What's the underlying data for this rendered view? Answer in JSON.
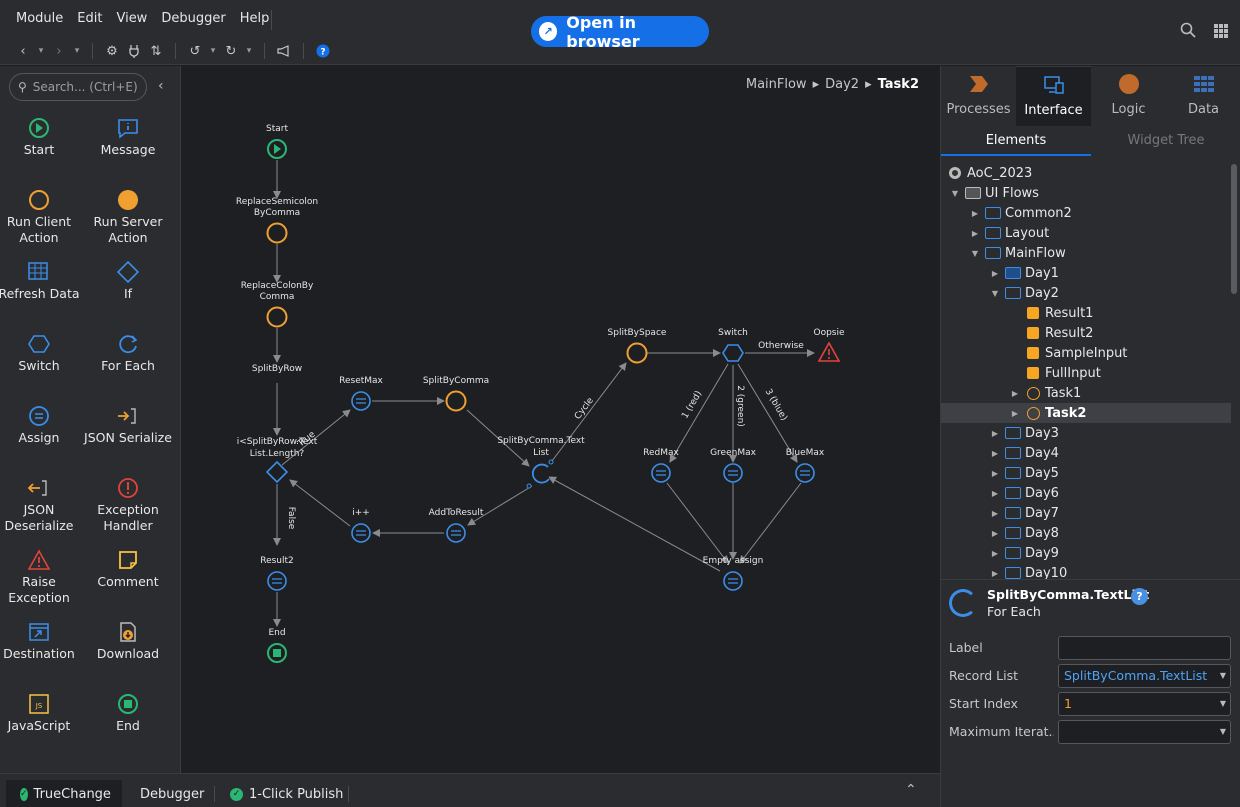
{
  "menu": [
    "Module",
    "Edit",
    "View",
    "Debugger",
    "Help"
  ],
  "open_browser": "Open in browser",
  "toolbox": {
    "search_placeholder": "Search... (Ctrl+E)",
    "tools": [
      {
        "label": "Start",
        "icon": "start-icon"
      },
      {
        "label": "Message",
        "icon": "message-icon"
      },
      {
        "label": "Run Client Action",
        "icon": "run-client-action-icon"
      },
      {
        "label": "Run Server Action",
        "icon": "run-server-action-icon"
      },
      {
        "label": "Refresh Data",
        "icon": "refresh-data-icon"
      },
      {
        "label": "If",
        "icon": "if-icon"
      },
      {
        "label": "Switch",
        "icon": "switch-icon"
      },
      {
        "label": "For Each",
        "icon": "for-each-icon"
      },
      {
        "label": "Assign",
        "icon": "assign-icon"
      },
      {
        "label": "JSON Serialize",
        "icon": "json-serialize-icon"
      },
      {
        "label": "JSON Deserialize",
        "icon": "json-deserialize-icon"
      },
      {
        "label": "Exception Handler",
        "icon": "exception-handler-icon"
      },
      {
        "label": "Raise Exception",
        "icon": "raise-exception-icon"
      },
      {
        "label": "Comment",
        "icon": "comment-icon"
      },
      {
        "label": "Destination",
        "icon": "destination-icon"
      },
      {
        "label": "Download",
        "icon": "download-icon"
      },
      {
        "label": "JavaScript",
        "icon": "javascript-icon"
      },
      {
        "label": "End",
        "icon": "end-icon"
      }
    ]
  },
  "breadcrumb": [
    "MainFlow",
    "Day2",
    "Task2"
  ],
  "flow": {
    "nodes": {
      "start": "Start",
      "replace_semicolon": [
        "ReplaceSemicolon",
        "ByComma"
      ],
      "replace_colon": [
        "ReplaceColonBy",
        "Comma"
      ],
      "split_by_row": "SplitByRow",
      "if_cond": [
        "i<SplitByRow.Text",
        "List.Length?"
      ],
      "result2": "Result2",
      "end": "End",
      "reset_max": "ResetMax",
      "split_by_comma": "SplitByComma",
      "foreach": [
        "SplitByComma.Text",
        "List"
      ],
      "i_plus": "i++",
      "add_to_result": "AddToResult",
      "split_by_space": "SplitBySpace",
      "switch": "Switch",
      "oopsie": "Oopsie",
      "red_max": "RedMax",
      "green_max": "GreenMax",
      "blue_max": "BlueMax",
      "empty_assign": "Empty assign"
    },
    "edges": {
      "true": "True",
      "false": "False",
      "cycle": "Cycle",
      "otherwise": "Otherwise",
      "red": "1 (red)",
      "green": "2 (green)",
      "blue": "3 (blue)"
    }
  },
  "right_panel": {
    "tabs": [
      "Processes",
      "Interface",
      "Logic",
      "Data"
    ],
    "active_tab": "Interface",
    "subtabs": [
      "Elements",
      "Widget Tree"
    ],
    "tree": [
      {
        "label": "AoC_2023"
      },
      {
        "label": "UI Flows"
      },
      {
        "label": "Common2"
      },
      {
        "label": "Layout"
      },
      {
        "label": "MainFlow"
      },
      {
        "label": "Day1"
      },
      {
        "label": "Day2"
      },
      {
        "label": "Result1"
      },
      {
        "label": "Result2"
      },
      {
        "label": "SampleInput"
      },
      {
        "label": "FullInput"
      },
      {
        "label": "Task1"
      },
      {
        "label": "Task2"
      },
      {
        "label": "Day3"
      },
      {
        "label": "Day4"
      },
      {
        "label": "Day5"
      },
      {
        "label": "Day6"
      },
      {
        "label": "Day7"
      },
      {
        "label": "Day8"
      },
      {
        "label": "Day9"
      },
      {
        "label": "Day10"
      }
    ],
    "properties": {
      "title": "SplitByComma.TextList",
      "subtitle": "For Each",
      "help": "?",
      "fields": [
        {
          "label": "Label",
          "value": ""
        },
        {
          "label": "Record List",
          "value": "SplitByComma.TextList"
        },
        {
          "label": "Start Index",
          "value": "1"
        },
        {
          "label": "Maximum Iterat...",
          "value": ""
        }
      ]
    }
  },
  "bottom_tabs": [
    "TrueChange",
    "Debugger",
    "1-Click Publish"
  ],
  "colors": {
    "accent": "#1570e8",
    "node_blue": "#3b8ee8",
    "node_orange": "#f0a030",
    "node_green": "#2bb673",
    "error_red": "#e0443a"
  }
}
